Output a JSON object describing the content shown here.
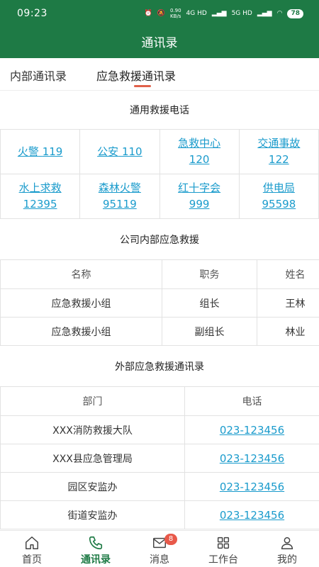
{
  "status_bar": {
    "time": "09:23",
    "net_speed_value": "0.90",
    "net_speed_unit": "KB/s",
    "signal_1": "4G HD",
    "signal_2": "5G HD",
    "battery": "78"
  },
  "header": {
    "title": "通讯录"
  },
  "tabs": [
    {
      "label": "内部通讯录",
      "active": false
    },
    {
      "label": "应急救援通讯录",
      "active": true
    }
  ],
  "general_section": {
    "title": "通用救援电话",
    "items": [
      {
        "name": "火警",
        "number": "119"
      },
      {
        "name": "公安",
        "number": "110"
      },
      {
        "name": "急救中心",
        "number": "120"
      },
      {
        "name": "交通事故",
        "number": "122"
      },
      {
        "name": "水上求救",
        "number": "12395"
      },
      {
        "name": "森林火警",
        "number": "95119"
      },
      {
        "name": "红十字会",
        "number": "999"
      },
      {
        "name": "供电局",
        "number": "95598"
      }
    ]
  },
  "internal_section": {
    "title": "公司内部应急救援",
    "columns": [
      "名称",
      "职务",
      "姓名"
    ],
    "rows": [
      [
        "应急救援小组",
        "组长",
        "王林"
      ],
      [
        "应急救援小组",
        "副组长",
        "林业"
      ]
    ]
  },
  "external_section": {
    "title": "外部应急救援通讯录",
    "columns": [
      "部门",
      "电话"
    ],
    "rows": [
      [
        "XXX消防救援大队",
        "023-123456"
      ],
      [
        "XXX县应急管理局",
        "023-123456"
      ],
      [
        "园区安监办",
        "023-123456"
      ],
      [
        "街道安监办",
        "023-123456"
      ]
    ]
  },
  "bottom_nav": [
    {
      "label": "首页",
      "icon": "home-icon",
      "active": false
    },
    {
      "label": "通讯录",
      "icon": "phone-icon",
      "active": true
    },
    {
      "label": "消息",
      "icon": "mail-icon",
      "active": false,
      "badge": "8"
    },
    {
      "label": "工作台",
      "icon": "grid-icon",
      "active": false
    },
    {
      "label": "我的",
      "icon": "person-icon",
      "active": false
    }
  ],
  "colors": {
    "primary": "#1e7a45",
    "link": "#1a9bcc",
    "indicator": "#e0604a",
    "badge": "#e8594a"
  }
}
